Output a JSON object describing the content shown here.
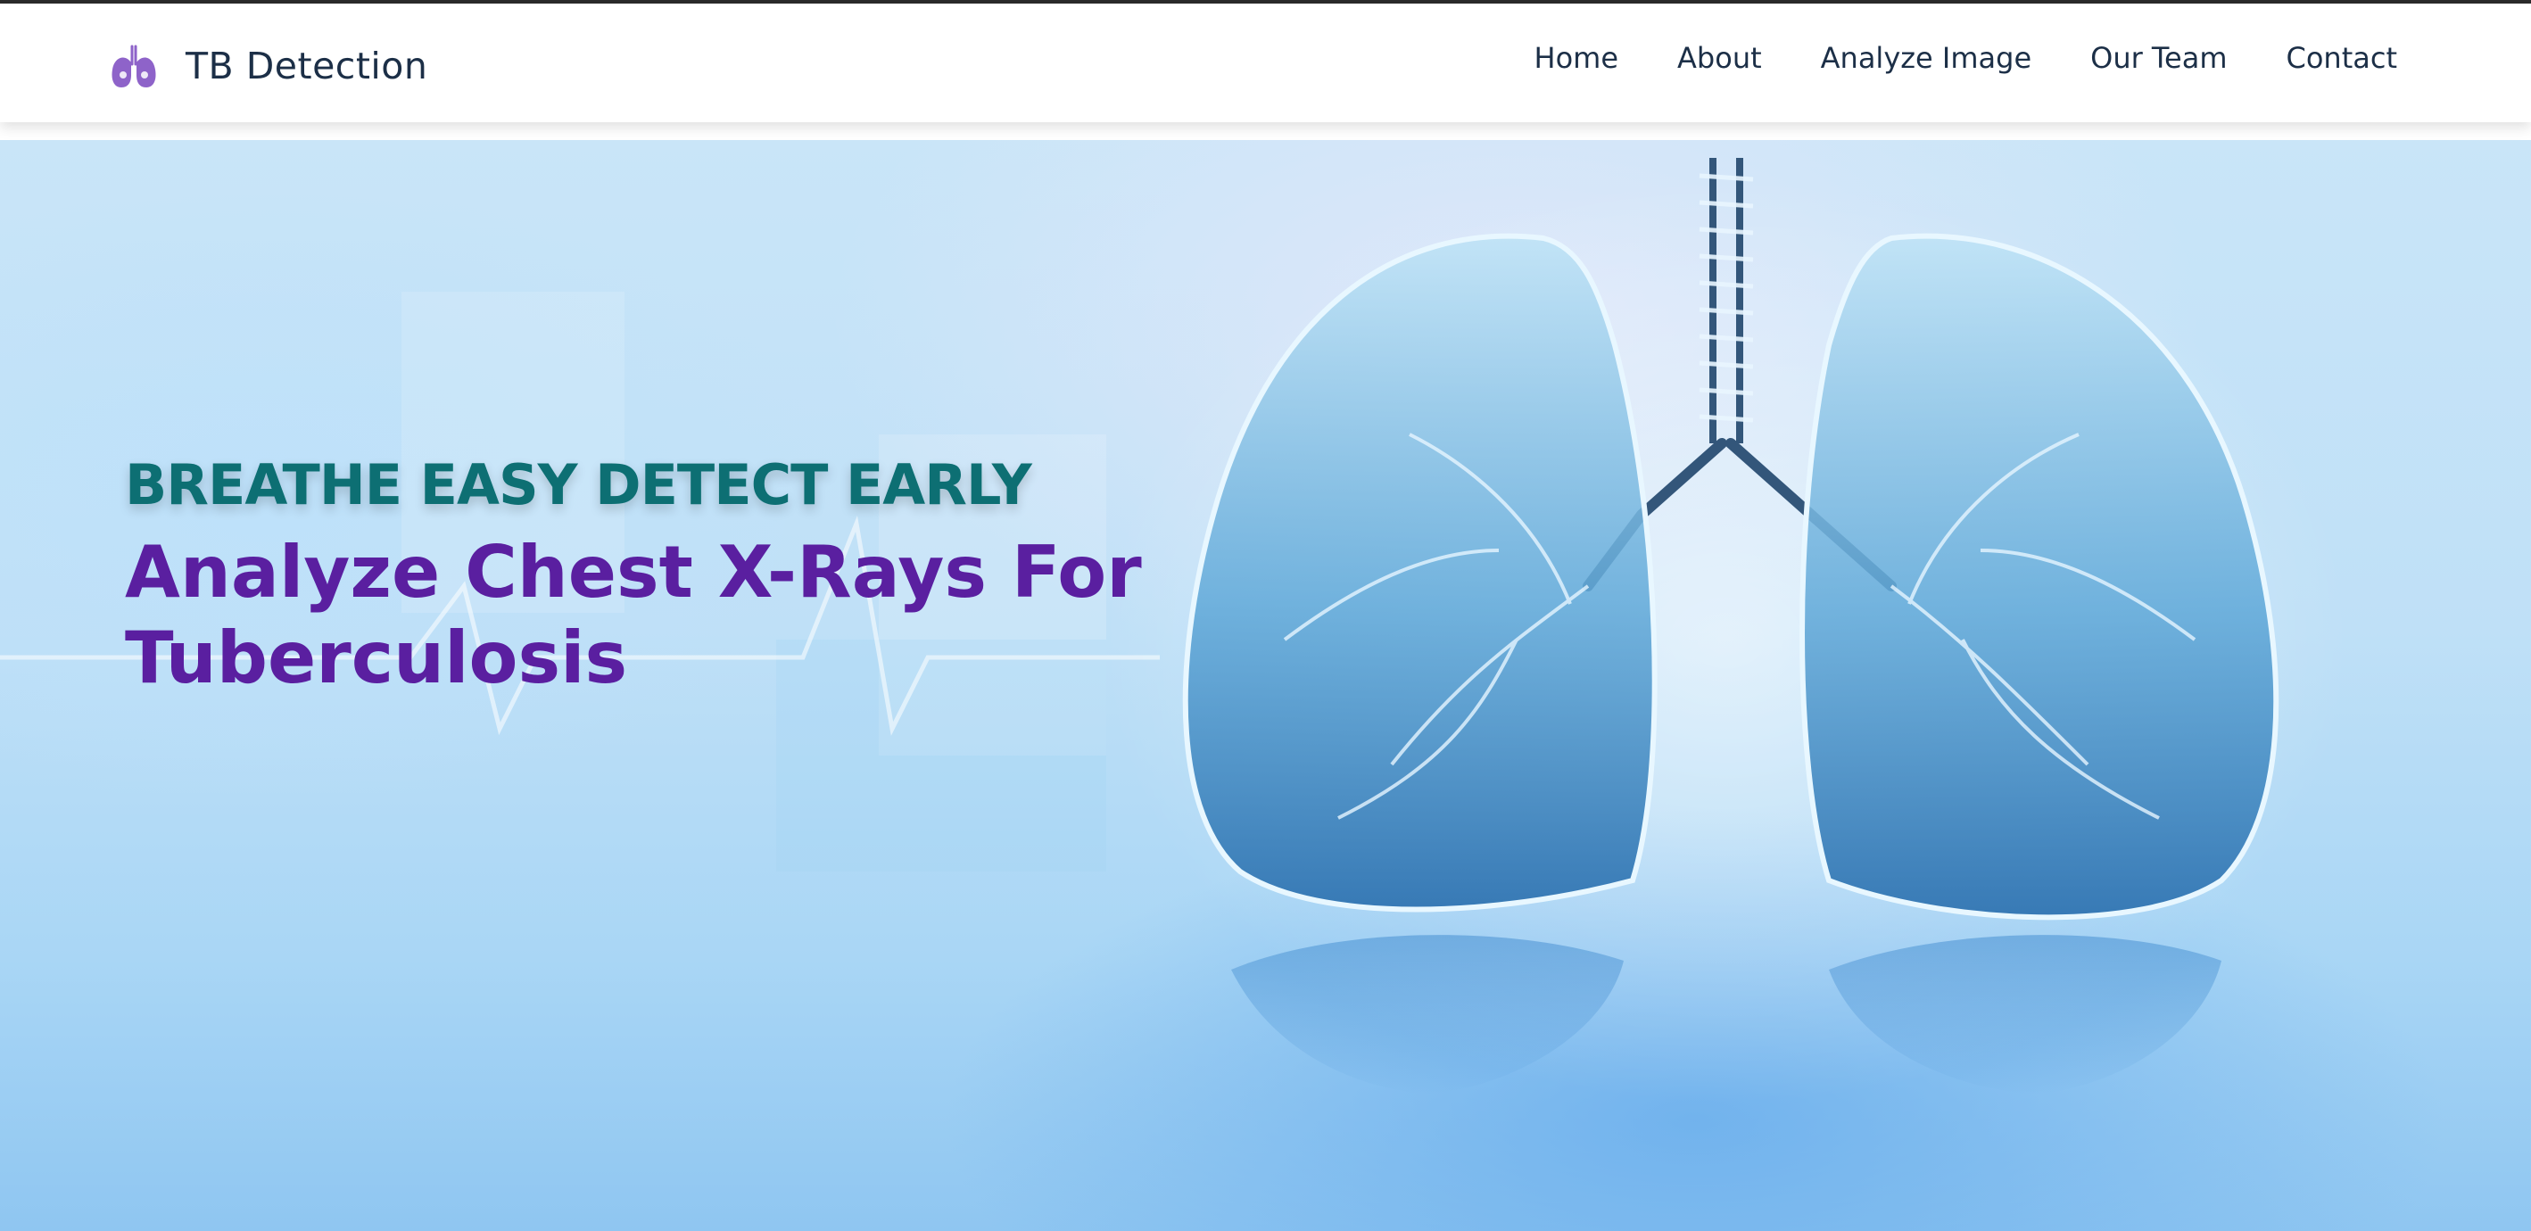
{
  "header": {
    "brand": "TB Detection",
    "brand_icon": "lungs-icon",
    "brand_icon_color": "#8e63c9",
    "nav": [
      {
        "label": "Home"
      },
      {
        "label": "About"
      },
      {
        "label": "Analyze Image"
      },
      {
        "label": "Our Team"
      },
      {
        "label": "Contact"
      }
    ]
  },
  "hero": {
    "tagline": "BREATHE EASY DETECT EARLY",
    "headline_line1": "Analyze Chest X-Rays For",
    "headline_line2": "Tuberculosis",
    "tagline_color": "#0d6f73",
    "headline_color": "#5a1fa0",
    "background_image": "lungs-illustration"
  }
}
